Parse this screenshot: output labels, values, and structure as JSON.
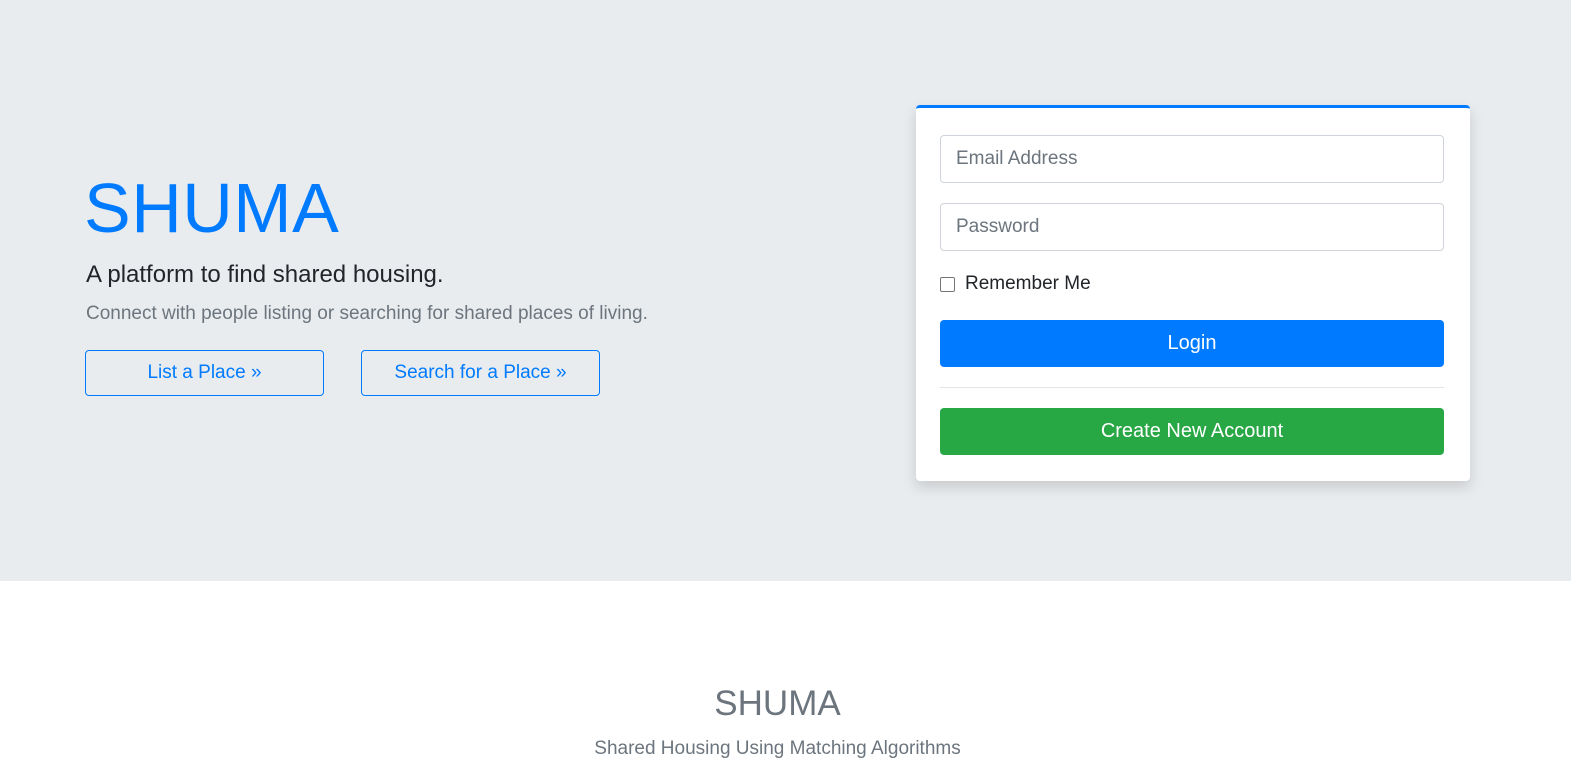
{
  "hero": {
    "title": "SHUMA",
    "tagline": "A platform to find shared housing.",
    "subline": "Connect with people listing or searching for shared places of living.",
    "list_button": "List a Place »",
    "search_button": "Search for a Place »"
  },
  "login": {
    "email_placeholder": "Email Address",
    "password_placeholder": "Password",
    "remember_label": "Remember Me",
    "remember_checked": false,
    "login_button": "Login",
    "create_button": "Create New Account"
  },
  "footer": {
    "title": "SHUMA",
    "subtitle": "Shared Housing Using Matching Algorithms"
  },
  "colors": {
    "accent": "#007bff",
    "success": "#28a745",
    "hero_bg": "#e9ecef",
    "muted": "#6c757d"
  }
}
